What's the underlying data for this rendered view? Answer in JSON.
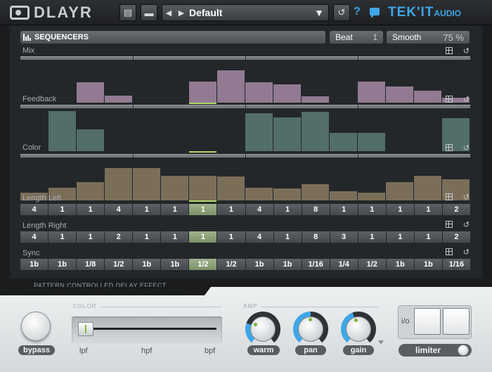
{
  "header": {
    "logo_text": "DLAYR",
    "preset_name": "Default",
    "brand": "TEK'IT",
    "brand_suffix": "AUDIO",
    "help_glyph": "?"
  },
  "icons": {
    "menu": "notebook-icon",
    "folder": "folder-icon",
    "prev": "chevron-left-icon",
    "next": "chevron-right-icon",
    "dropdown": "triangle-down-icon",
    "undo": "undo-icon",
    "help": "help-icon",
    "chat": "chat-icon"
  },
  "sequencer": {
    "title": "SEQUENCERS",
    "beat_label": "Beat",
    "beat_value": "1",
    "smooth_label": "Smooth",
    "smooth_value": "75 %",
    "current_step": 6
  },
  "lanes": [
    {
      "label": "Mix",
      "color": "#a48aa4",
      "values": [
        0,
        0,
        0.5,
        0.18,
        0,
        0,
        0.52,
        0.8,
        0.5,
        0.45,
        0.15,
        0,
        0.52,
        0.4,
        0.3,
        0.12
      ]
    },
    {
      "label": "Feedback",
      "color": "#5a7a76",
      "values": [
        0,
        1.0,
        0.55,
        0,
        0,
        0,
        0,
        0,
        0.95,
        0.85,
        0.98,
        0.45,
        0.45,
        0,
        0,
        0.82
      ]
    },
    {
      "label": "Color",
      "color": "#8b7b62",
      "values": [
        0.2,
        0.32,
        0.46,
        0.8,
        0.8,
        0.62,
        0.62,
        0.6,
        0.32,
        0.3,
        0.4,
        0.22,
        0.2,
        0.46,
        0.62,
        0.52
      ]
    }
  ],
  "length_left": {
    "label": "Length Left",
    "steps": [
      "4",
      "1",
      "1",
      "4",
      "1",
      "1",
      "1",
      "1",
      "4",
      "1",
      "8",
      "1",
      "1",
      "1",
      "1",
      "2"
    ]
  },
  "length_right": {
    "label": "Length Right",
    "steps": [
      "4",
      "1",
      "1",
      "2",
      "1",
      "1",
      "1",
      "1",
      "4",
      "1",
      "8",
      "3",
      "1",
      "1",
      "1",
      "2"
    ]
  },
  "sync": {
    "label": "Sync",
    "steps": [
      "1b",
      "1b",
      "1/8",
      "1/2",
      "1b",
      "1b",
      "1/2",
      "1/2",
      "1b",
      "1b",
      "1/16",
      "1/4",
      "1/2",
      "1b",
      "1b",
      "1/16"
    ]
  },
  "subtitle": "PATTERN CONTROLLED DELAY EFFECT",
  "bottom": {
    "bypass_label": "bypass",
    "color_group": "COLOR",
    "color_labels": [
      "lpf",
      "hpf",
      "bpf"
    ],
    "amp_group": "AMP",
    "knobs": [
      {
        "label": "warm",
        "fill_deg": 70
      },
      {
        "label": "pan",
        "fill_deg": 140
      },
      {
        "label": "gain",
        "fill_deg": 120
      }
    ],
    "io_label": "i/o",
    "limiter_label": "limiter"
  }
}
